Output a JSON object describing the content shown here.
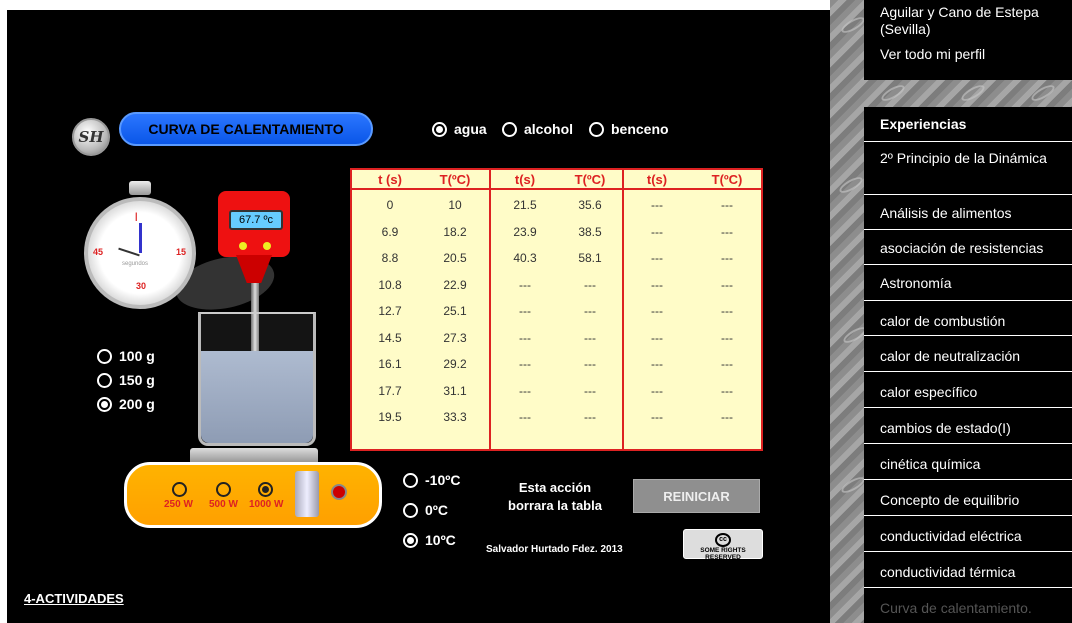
{
  "sidebar": {
    "profile_lines": [
      "Aguilar y Cano de Estepa",
      "(Sevilla)",
      "Ver todo mi perfil"
    ],
    "experiences_title": "Experiencias",
    "items": [
      "2º Principio de la Dinámica",
      "Análisis de alimentos",
      "asociación de resistencias",
      "Astronomía",
      "calor de combustión",
      "calor de neutralización",
      "calor específico",
      "cambios de estado(I)",
      "cinética química",
      "Concepto de equilibrio",
      "conductividad eléctrica",
      "conductividad térmica",
      "Curva de calentamiento."
    ]
  },
  "sim": {
    "logo_text": "SH",
    "title": "CURVA DE CALENTAMIENTO",
    "substances": [
      {
        "label": "agua",
        "selected": true
      },
      {
        "label": "alcohol",
        "selected": false
      },
      {
        "label": "benceno",
        "selected": false
      }
    ],
    "masses": [
      {
        "label": "100 g",
        "selected": false
      },
      {
        "label": "150 g",
        "selected": false
      },
      {
        "label": "200 g",
        "selected": true
      }
    ],
    "powers": [
      {
        "label": "250 W",
        "selected": false
      },
      {
        "label": "500 W",
        "selected": false
      },
      {
        "label": "1000 W",
        "selected": true
      }
    ],
    "initial_temps": [
      {
        "label": "-10ºC",
        "selected": false
      },
      {
        "label": "0ºC",
        "selected": false
      },
      {
        "label": "10ºC",
        "selected": true
      }
    ],
    "thermometer_reading": "67.7 ºc",
    "stopwatch": {
      "n45": "45",
      "n15": "15",
      "n30": "30",
      "label": "segundos"
    },
    "warning": "Esta acción borrara la tabla",
    "reset_label": "REINICIAR",
    "author": "Salvador Hurtado Fdez. 2013",
    "cc_text": "SOME RIGHTS RESERVED",
    "cc_mark": "cc",
    "activities_link": "4-ACTIVIDADES"
  },
  "table": {
    "headers": [
      "t (s)",
      "T(ºC)",
      "t(s)",
      "T(ºC)",
      "t(s)",
      "T(ºC)"
    ],
    "rows": [
      [
        "0",
        "10",
        "21.5",
        "35.6",
        "---",
        "---"
      ],
      [
        "6.9",
        "18.2",
        "23.9",
        "38.5",
        "---",
        "---"
      ],
      [
        "8.8",
        "20.5",
        "40.3",
        "58.1",
        "---",
        "---"
      ],
      [
        "10.8",
        "22.9",
        "---",
        "---",
        "---",
        "---"
      ],
      [
        "12.7",
        "25.1",
        "---",
        "---",
        "---",
        "---"
      ],
      [
        "14.5",
        "27.3",
        "---",
        "---",
        "---",
        "---"
      ],
      [
        "16.1",
        "29.2",
        "---",
        "---",
        "---",
        "---"
      ],
      [
        "17.7",
        "31.1",
        "---",
        "---",
        "---",
        "---"
      ],
      [
        "19.5",
        "33.3",
        "---",
        "---",
        "---",
        "---"
      ]
    ]
  }
}
